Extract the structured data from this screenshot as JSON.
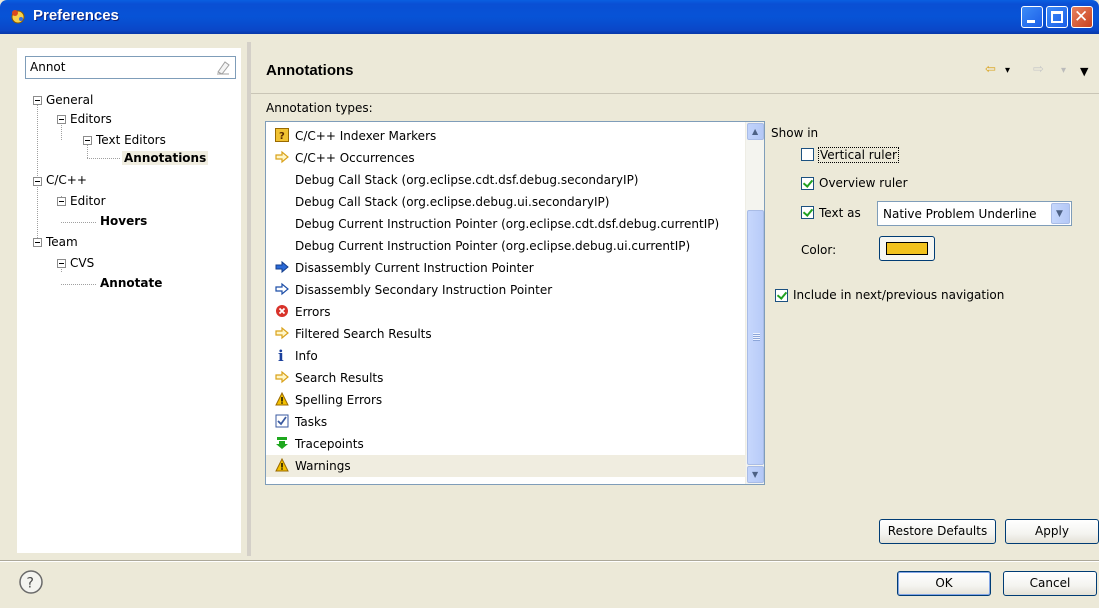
{
  "window": {
    "title": "Preferences",
    "minimize_label": "_",
    "maximize_label": "□",
    "close_label": "✕"
  },
  "filter": {
    "value": "Annot"
  },
  "tree": [
    {
      "label": "General"
    },
    {
      "label": "Editors"
    },
    {
      "label": "Text Editors"
    },
    {
      "label": "Annotations"
    },
    {
      "label": "C/C++"
    },
    {
      "label": "Editor"
    },
    {
      "label": "Hovers"
    },
    {
      "label": "Team"
    },
    {
      "label": "CVS"
    },
    {
      "label": "Annotate"
    }
  ],
  "page": {
    "title": "Annotations",
    "back_icon": "⇦",
    "forward_icon": "⇨",
    "menu_icon": "▼",
    "dropdown_icon": "▾"
  },
  "annotations": {
    "label": "Annotation types:",
    "items": [
      {
        "label": "C/C++ Indexer Markers",
        "icon": "question-marker-icon"
      },
      {
        "label": "C/C++ Occurrences",
        "icon": "yellow-arrow-icon"
      },
      {
        "label": "Debug Call Stack (org.eclipse.cdt.dsf.debug.secondaryIP)",
        "icon": ""
      },
      {
        "label": "Debug Call Stack (org.eclipse.debug.ui.secondaryIP)",
        "icon": ""
      },
      {
        "label": "Debug Current Instruction Pointer (org.eclipse.cdt.dsf.debug.currentIP)",
        "icon": ""
      },
      {
        "label": "Debug Current Instruction Pointer (org.eclipse.debug.ui.currentIP)",
        "icon": ""
      },
      {
        "label": "Disassembly Current Instruction Pointer",
        "icon": "blue-arrow-icon"
      },
      {
        "label": "Disassembly Secondary Instruction Pointer",
        "icon": "outline-arrow-icon"
      },
      {
        "label": "Errors",
        "icon": "error-icon"
      },
      {
        "label": "Filtered Search Results",
        "icon": "yellow-arrow-icon"
      },
      {
        "label": "Info",
        "icon": "info-icon"
      },
      {
        "label": "Search Results",
        "icon": "yellow-arrow-icon"
      },
      {
        "label": "Spelling Errors",
        "icon": "warning-icon"
      },
      {
        "label": "Tasks",
        "icon": "task-icon"
      },
      {
        "label": "Tracepoints",
        "icon": "tracepoint-icon"
      },
      {
        "label": "Warnings",
        "icon": "warning-icon"
      }
    ]
  },
  "options": {
    "show_in": "Show in",
    "vertical_ruler": "Vertical ruler",
    "vertical_ruler_checked": false,
    "overview_ruler": "Overview ruler",
    "overview_ruler_checked": true,
    "text_as": "Text as",
    "text_as_checked": true,
    "text_style": "Native Problem Underline",
    "color_label": "Color:",
    "color_value": "#f2c21d",
    "include_nav": "Include in next/previous navigation",
    "include_nav_checked": true
  },
  "buttons": {
    "restore_defaults": "Restore Defaults",
    "apply": "Apply",
    "ok": "OK",
    "cancel": "Cancel"
  }
}
